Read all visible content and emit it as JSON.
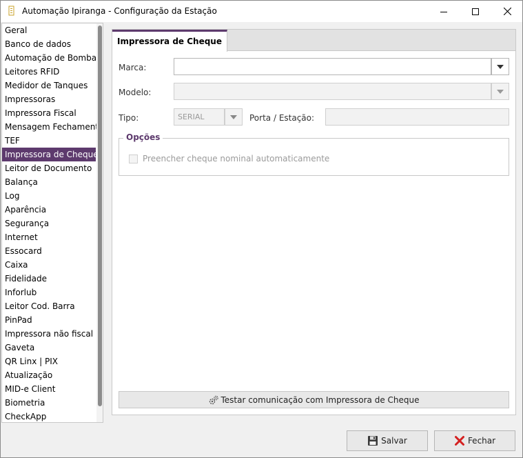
{
  "window": {
    "title": "Automação Ipiranga - Configuração da Estação",
    "minimize_icon": "minimize-icon",
    "maximize_icon": "maximize-icon",
    "close_icon": "close-icon"
  },
  "sidebar": {
    "items": [
      {
        "label": "Geral"
      },
      {
        "label": "Banco de dados"
      },
      {
        "label": "Automação de Bombas"
      },
      {
        "label": "Leitores RFID"
      },
      {
        "label": "Medidor de Tanques"
      },
      {
        "label": "Impressoras"
      },
      {
        "label": "Impressora Fiscal"
      },
      {
        "label": "Mensagem Fechamento"
      },
      {
        "label": "TEF"
      },
      {
        "label": "Impressora de Cheque",
        "active": true
      },
      {
        "label": "Leitor de Documento"
      },
      {
        "label": "Balança"
      },
      {
        "label": "Log"
      },
      {
        "label": "Aparência"
      },
      {
        "label": "Segurança"
      },
      {
        "label": "Internet"
      },
      {
        "label": "Essocard"
      },
      {
        "label": "Caixa"
      },
      {
        "label": "Fidelidade"
      },
      {
        "label": "Inforlub"
      },
      {
        "label": "Leitor Cod. Barra"
      },
      {
        "label": "PinPad"
      },
      {
        "label": "Impressora não fiscal"
      },
      {
        "label": "Gaveta"
      },
      {
        "label": "QR Linx | PIX"
      },
      {
        "label": "Atualização"
      },
      {
        "label": "MID-e Client"
      },
      {
        "label": "Biometria"
      },
      {
        "label": "CheckApp"
      }
    ]
  },
  "panel": {
    "tab_label": "Impressora de Cheque",
    "marca_label": "Marca:",
    "marca_value": "",
    "modelo_label": "Modelo:",
    "modelo_value": "",
    "tipo_label": "Tipo:",
    "tipo_value": "SERIAL",
    "porta_label": "Porta / Estação:",
    "porta_value": "",
    "options_title": "Opções",
    "nominal_checkbox_label": "Preencher cheque nominal automaticamente",
    "nominal_checked": false,
    "test_button_label": "Testar comunicação com Impressora de Cheque"
  },
  "footer": {
    "save_label": "Salvar",
    "close_label": "Fechar"
  },
  "colors": {
    "accent": "#5d3a6d",
    "window_bg": "#f0f0f0"
  }
}
